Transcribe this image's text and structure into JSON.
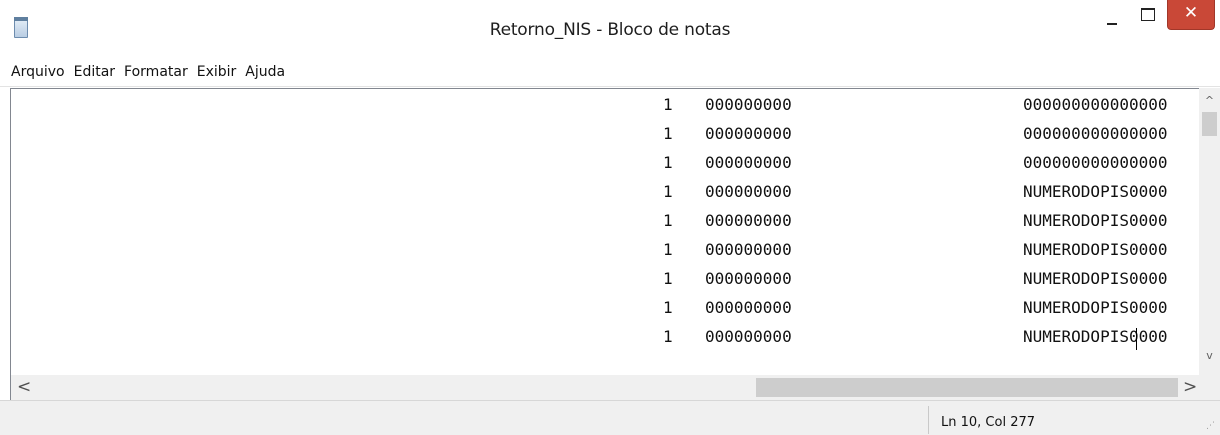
{
  "window": {
    "title": "Retorno_NIS - Bloco de notas",
    "icon": "notepad-icon",
    "close_glyph": "✕"
  },
  "menu": [
    "Arquivo",
    "Editar",
    "Formatar",
    "Exibir",
    "Ajuda"
  ],
  "editor": {
    "lines": [
      {
        "a": "1",
        "b": "000000000",
        "c": "000000000000000"
      },
      {
        "a": "1",
        "b": "000000000",
        "c": "000000000000000"
      },
      {
        "a": "1",
        "b": "000000000",
        "c": "000000000000000"
      },
      {
        "a": "1",
        "b": "000000000",
        "c": "NUMERODOPIS0000"
      },
      {
        "a": "1",
        "b": "000000000",
        "c": "NUMERODOPIS0000"
      },
      {
        "a": "1",
        "b": "000000000",
        "c": "NUMERODOPIS0000"
      },
      {
        "a": "1",
        "b": "000000000",
        "c": "NUMERODOPIS0000"
      },
      {
        "a": "1",
        "b": "000000000",
        "c": "NUMERODOPIS0000"
      },
      {
        "a": "1",
        "b": "000000000",
        "c": "NUMERODOPIS0000"
      }
    ]
  },
  "scroll": {
    "up_glyph": "^",
    "down_glyph": "v",
    "left_glyph": "<",
    "right_glyph": ">"
  },
  "status": {
    "position": "Ln 10, Col 277"
  },
  "colors": {
    "close_button": "#c94837",
    "scrollbar": "#f0f0f0",
    "scroll_thumb": "#cdcdcd"
  }
}
